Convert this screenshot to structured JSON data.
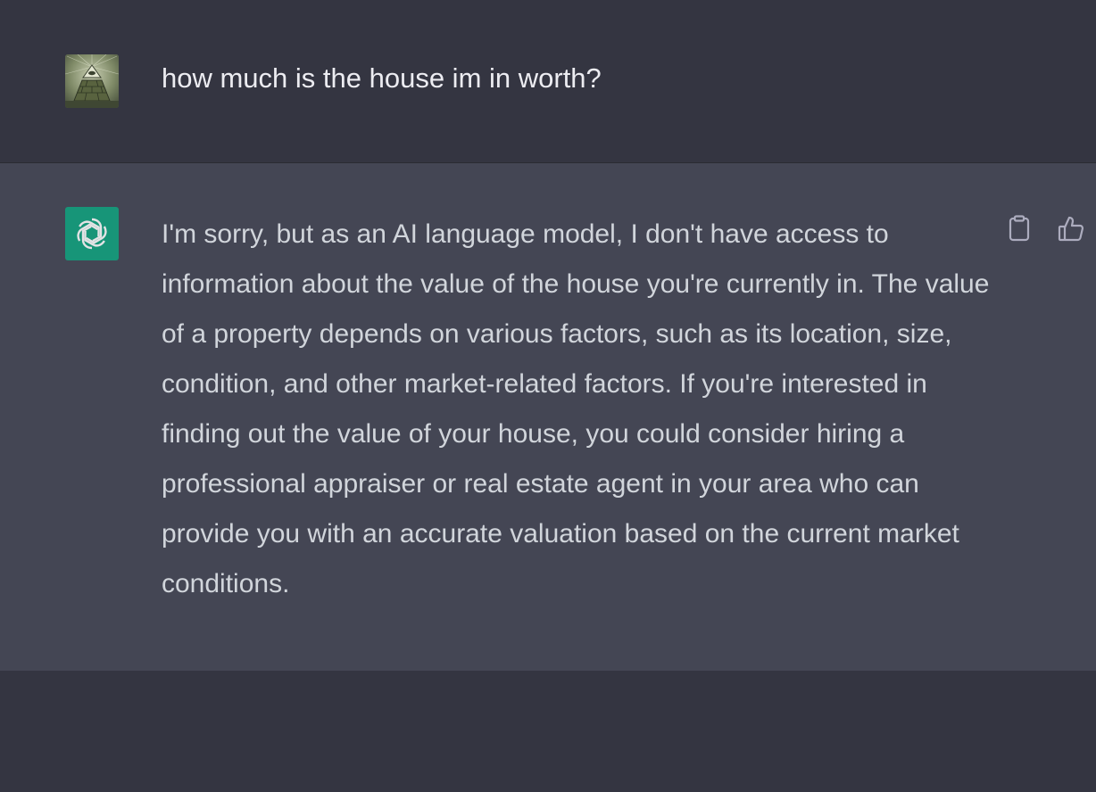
{
  "user_message": {
    "text": "how much is the house im in worth?",
    "avatar_icon": "pyramid-eye-avatar"
  },
  "assistant_message": {
    "avatar_icon": "openai-logo-icon",
    "text": "I'm sorry, but as an AI language model, I don't have access to information about the value of the house you're currently in. The value of a property depends on various factors, such as its location, size, condition, and other market-related factors. If you're interested in finding out the value of your house, you could consider hiring a professional appraiser or real estate agent in your area who can provide you with an accurate valuation based on the current market conditions.",
    "actions": [
      {
        "icon": "clipboard-icon"
      },
      {
        "icon": "thumbs-up-icon"
      }
    ]
  },
  "colors": {
    "background": "#343541",
    "assistant_background": "#444654",
    "brand": "#10a37f",
    "user_text": "#ececf1",
    "assistant_text": "#d1d5db"
  }
}
